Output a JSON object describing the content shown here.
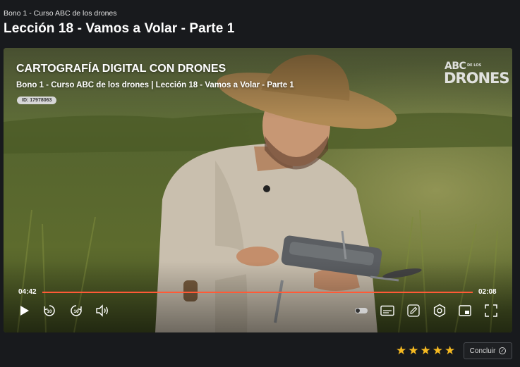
{
  "header": {
    "breadcrumb": "Bono 1 - Curso ABC de los drones",
    "title": "Lección 18 - Vamos a Volar - Parte 1"
  },
  "video": {
    "overlay_title": "CARTOGRAFÍA DIGITAL CON DRONES",
    "overlay_subtitle": "Bono 1 - Curso ABC de los drones | Lección 18 - Vamos a Volar - Parte 1",
    "id_badge": "ID: 17978063",
    "logo": {
      "abc": "ABC",
      "sub": "DE LOS",
      "drones": "DRONES"
    },
    "current_time": "04:42",
    "total_time": "02:08",
    "progress_fraction": 1.0,
    "buffered_fraction": 0.85,
    "accent_color": "#ff5a36",
    "controls": {
      "play": "play-icon",
      "rewind": "rewind-10-icon",
      "forward": "forward-10-icon",
      "volume": "volume-icon",
      "toggle": "toggle-icon",
      "captions": "captions-icon",
      "notes": "pencil-icon",
      "settings": "settings-icon",
      "pip": "picture-in-picture-icon",
      "fullscreen": "fullscreen-icon"
    },
    "skip_seconds": "10"
  },
  "footer": {
    "rating": 5,
    "star_color": "#f5b921",
    "complete_label": "Concluir"
  }
}
